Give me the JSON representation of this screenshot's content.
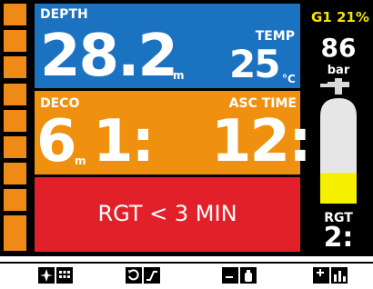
{
  "depth": {
    "label": "DEPTH",
    "value": "28.2",
    "unit": "m"
  },
  "temp": {
    "label": "TEMP",
    "value": "25",
    "unit": "°C"
  },
  "deco": {
    "label": "DECO",
    "depth_value": "6",
    "depth_unit": "m",
    "time_value": "1:"
  },
  "asc_time": {
    "label": "ASC TIME",
    "value": "12:"
  },
  "alert": {
    "text": "RGT < 3 MIN"
  },
  "gas": {
    "label": "G1 21%",
    "pressure": "86",
    "pressure_unit": "bar",
    "tank_fill": 0.35
  },
  "rgt": {
    "label": "RGT",
    "value": "2:"
  },
  "colors": {
    "depth_panel": "#1b72c0",
    "deco_panel": "#f0900f",
    "alert_panel": "#e2202a",
    "gas_label": "#f5e400",
    "tank_fill": "#f5f000"
  },
  "softkeys": [
    {
      "icons": [
        "compass-icon",
        "grid-icon"
      ]
    },
    {
      "icons": [
        "refresh-icon",
        "graph-icon"
      ]
    },
    {
      "icons": [
        "minus-bookmark-icon",
        "tank-icon"
      ]
    },
    {
      "icons": [
        "plus-bookmark-icon",
        "bar-chart-icon"
      ]
    }
  ]
}
